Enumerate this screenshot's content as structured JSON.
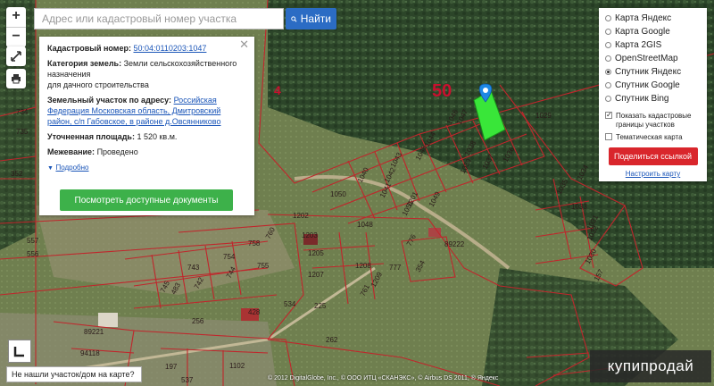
{
  "search": {
    "placeholder": "Адрес или кадастровый номер участка",
    "button_label": "Найти"
  },
  "zoom": {
    "plus": "+",
    "minus": "−"
  },
  "info_card": {
    "cadastral_label": "Кадастровый номер:",
    "cadastral_value": "50:04:0110203:1047",
    "category_label": "Категория земель:",
    "category_value": "Земли сельскохозяйственного назначения",
    "category_use": "для дачного строительства",
    "address_label": "Земельный участок по адресу:",
    "address_value": "Российская Федерация Московская область, Дмитровский район, с/п Габовское, в районе д.Овсянниково",
    "area_label": "Уточненная площадь:",
    "area_value": "1 520 кв.м.",
    "survey_label": "Межевание:",
    "survey_value": "Проведено",
    "more_link": "Подробно",
    "docs_button": "Посмотреть доступные документы"
  },
  "layers": {
    "options": [
      {
        "label": "Карта Яндекс",
        "selected": false
      },
      {
        "label": "Карта Google",
        "selected": false
      },
      {
        "label": "Карта 2GIS",
        "selected": false
      },
      {
        "label": "OpenStreetMap",
        "selected": false
      },
      {
        "label": "Спутник Яндекс",
        "selected": true
      },
      {
        "label": "Спутник Google",
        "selected": false
      },
      {
        "label": "Спутник Bing",
        "selected": false
      }
    ],
    "show_borders_label": "Показать кадастровые границы участков",
    "show_borders_checked": true,
    "thematic_label": "Тематическая карта",
    "thematic_checked": false,
    "share_button": "Поделиться ссылкой",
    "setup_link": "Настроить карту"
  },
  "map_labels": {
    "quarter_50": "50",
    "quarter_4": "4",
    "plots": [
      "734",
      "735",
      "352",
      "557",
      "556",
      "1029",
      "1048",
      "1046",
      "1044",
      "1045",
      "1043",
      "1042",
      "1040",
      "1041",
      "1038",
      "1039",
      "1037",
      "1036",
      "1035",
      "1034",
      "1033",
      "1032",
      "1031",
      "1030",
      "1050",
      "1051",
      "1049",
      "1201",
      "1202",
      "1203",
      "1205",
      "1208",
      "1209",
      "1207",
      "761",
      "758",
      "760",
      "755",
      "754",
      "744",
      "743",
      "742",
      "745",
      "483",
      "256",
      "428",
      "534",
      "225",
      "262",
      "197",
      "1102",
      "537",
      "777",
      "776",
      "354",
      "89222",
      "89221",
      "94118",
      "157"
    ],
    "selected_plot": "1047"
  },
  "bottom": {
    "not_found_link": "Не нашли участок/дом на карте?",
    "copyright": "© 2012 DigitalGlobe, Inc., © ООО ИТЦ «СКАНЭКС», © Airbus DS 2011, ® Яндекс",
    "brand": "купипродай"
  },
  "colors": {
    "parcel_border": "#c0262c",
    "selected_parcel": "#39e639",
    "marker": "#1e88e5",
    "satellite_forest": "#2f4a2c",
    "satellite_field": "#7a8a58"
  }
}
